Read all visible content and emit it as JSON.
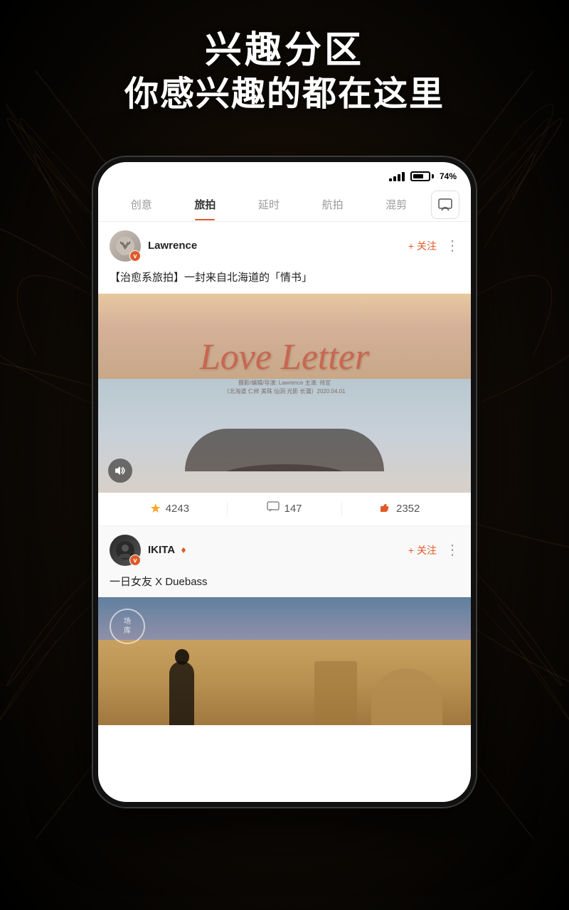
{
  "background": {
    "title1": "兴趣分区",
    "title2": "你感兴趣的都在这里"
  },
  "statusBar": {
    "battery": "74%"
  },
  "tabs": {
    "items": [
      {
        "label": "创意",
        "active": false
      },
      {
        "label": "旅拍",
        "active": true
      },
      {
        "label": "延时",
        "active": false
      },
      {
        "label": "航拍",
        "active": false
      },
      {
        "label": "混剪",
        "active": false
      }
    ],
    "icon": "💬"
  },
  "post1": {
    "username": "Lawrence",
    "verified": "V",
    "follow": "+ 关注",
    "more": "⋮",
    "title": "【治愈系旅拍】一封来自北海道的「情书」",
    "imageText": "Love Letter",
    "stats": {
      "stars": "4243",
      "comments": "147",
      "likes": "2352"
    }
  },
  "post2": {
    "username": "IKITA",
    "diamond": "♦",
    "verified": "V",
    "follow": "+ 关注",
    "more": "⋮",
    "title": "一日女友 X Duebass",
    "sceneLabel": "场\n库"
  }
}
